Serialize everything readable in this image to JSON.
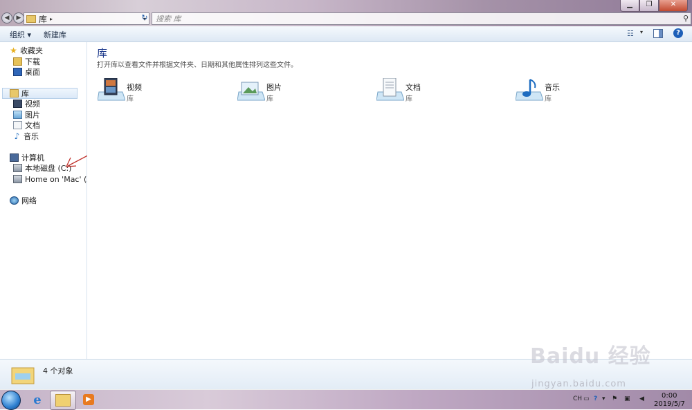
{
  "window": {
    "min_label": "▁",
    "max_label": "❐",
    "close_label": "✕"
  },
  "address": {
    "path": "库",
    "sep": "▸",
    "dropdown": "▾",
    "refresh": "↻"
  },
  "search": {
    "placeholder": "搜索 库"
  },
  "toolbar": {
    "organize_label": "组织 ▾",
    "new_library_label": "新建库",
    "help_label": "?"
  },
  "nav": {
    "favorites": "收藏夹",
    "downloads": "下载",
    "desktop": "桌面",
    "libraries": "库",
    "videos": "视频",
    "pictures": "图片",
    "documents": "文档",
    "music": "音乐",
    "computer": "计算机",
    "local_disk": "本地磁盘 (C:)",
    "mac_home": "Home on 'Mac' (Z:)",
    "network": "网络"
  },
  "content": {
    "title": "库",
    "description": "打开库以查看文件并根据文件夹、日期和其他属性排列这些文件。",
    "libraries": [
      {
        "name": "视频",
        "type": "库",
        "icon": "video-library-icon"
      },
      {
        "name": "图片",
        "type": "库",
        "icon": "pictures-library-icon"
      },
      {
        "name": "文档",
        "type": "库",
        "icon": "documents-library-icon"
      },
      {
        "name": "音乐",
        "type": "库",
        "icon": "music-library-icon"
      }
    ]
  },
  "status": {
    "count": "4 个对象"
  },
  "watermark": {
    "logo": "Baidu 经验",
    "url": "jingyan.baidu.com"
  },
  "taskbar": {
    "lang": "CH",
    "time": "0:00",
    "date": "2019/5/7"
  },
  "colors": {
    "accent": "#1e3a8c",
    "annotation": "#c0302a"
  }
}
